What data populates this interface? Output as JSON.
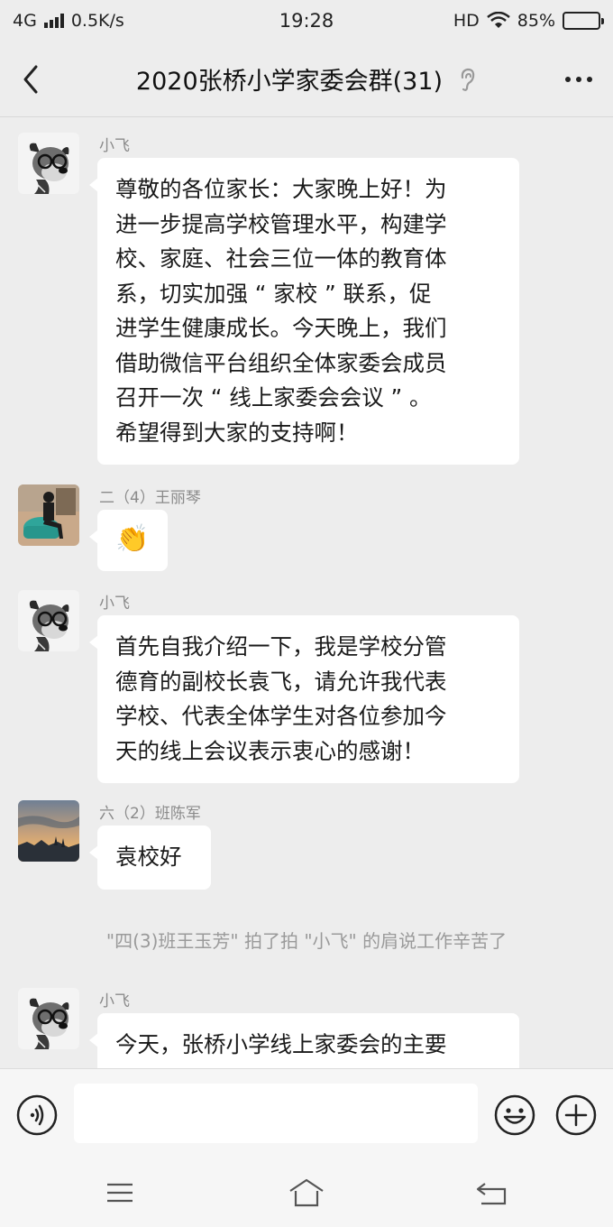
{
  "status_bar": {
    "network": "4G",
    "speed": "0.5K/s",
    "time": "19:28",
    "hd": "HD",
    "battery": "85%",
    "battery_level": 0.85,
    "icons": [
      "signal-icon",
      "wifi-icon",
      "battery-icon"
    ]
  },
  "header": {
    "title": "2020张桥小学家委会群(31)",
    "back_icon": "chevron-left-icon",
    "ear_icon": "ear-icon",
    "more_icon": "more-icon"
  },
  "messages": [
    {
      "sender": "小飞",
      "avatar": "dog-avatar",
      "text": "尊敬的各位家长：大家晚上好！为\n进一步提高学校管理水平，构建学\n校、家庭、社会三位一体的教育体\n系，切实加强 “ 家校 ” 联系，促\n进学生健康成长。今天晚上，我们\n借助微信平台组织全体家委会成员\n召开一次 “ 线上家委会会议 ” 。\n希望得到大家的支持啊！"
    },
    {
      "sender": "二（4）王丽琴",
      "avatar": "person-chair-avatar",
      "text": "👏"
    },
    {
      "sender": "小飞",
      "avatar": "dog-avatar",
      "text": "首先自我介绍一下，我是学校分管\n德育的副校长袁飞，请允许我代表\n学校、代表全体学生对各位参加今\n天的线上会议表示衷心的感谢！"
    },
    {
      "sender": "六（2）班陈军",
      "avatar": "sunset-avatar",
      "text": "袁校好"
    },
    {
      "sender": "小飞",
      "avatar": "dog-avatar",
      "text": "今天，张桥小学线上家委会的主要\n议题有："
    }
  ],
  "system_tip": "\"四(3)班王玉芳\" 拍了拍 \"小飞\" 的肩说工作辛苦了",
  "input_bar": {
    "placeholder": "",
    "value": "",
    "voice_icon": "voice-icon",
    "emoji_icon": "emoji-icon",
    "plus_icon": "plus-icon"
  },
  "nav_bar": {
    "icons": [
      "menu-icon",
      "home-icon",
      "back-icon"
    ]
  },
  "colors": {
    "background": "#ededed",
    "bubble": "#ffffff",
    "muted_text": "#8a8a8a"
  }
}
